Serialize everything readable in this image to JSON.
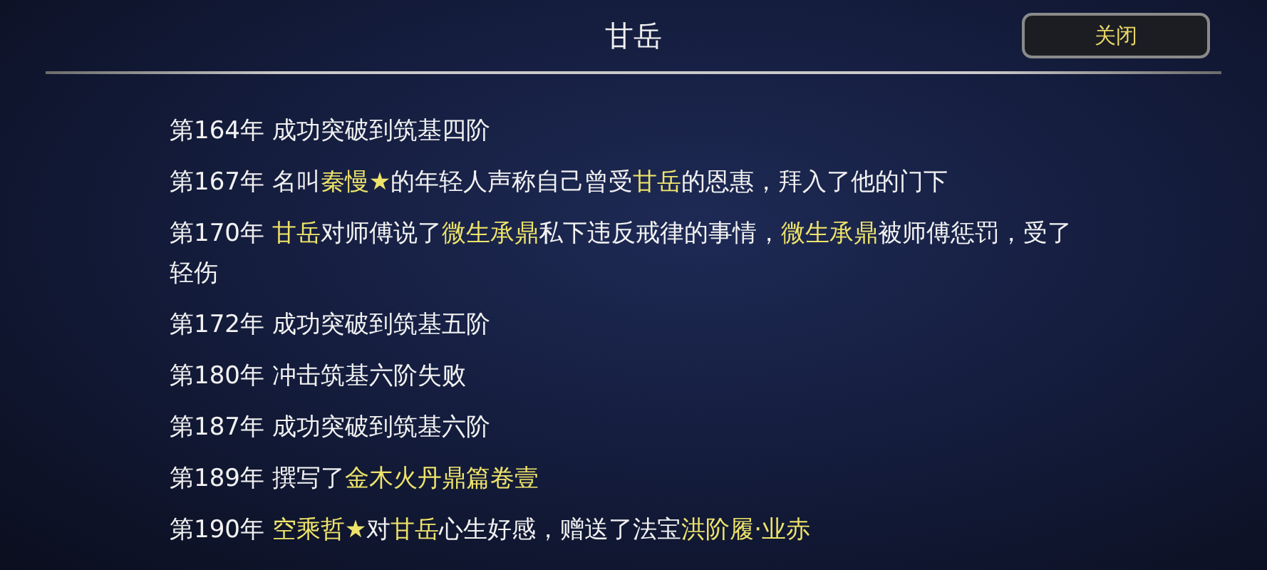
{
  "header": {
    "title": "甘岳",
    "close_button": "关闭"
  },
  "entries": [
    {
      "year": "第164年",
      "segments": [
        {
          "text": "成功突破到筑基四阶",
          "highlight": false
        }
      ]
    },
    {
      "year": "第167年",
      "segments": [
        {
          "text": "名叫",
          "highlight": false
        },
        {
          "text": "秦慢★",
          "highlight": true
        },
        {
          "text": "的年轻人声称自己曾受",
          "highlight": false
        },
        {
          "text": "甘岳",
          "highlight": true
        },
        {
          "text": "的恩惠，拜入了他的门下",
          "highlight": false
        }
      ]
    },
    {
      "year": "第170年",
      "segments": [
        {
          "text": "甘岳",
          "highlight": true
        },
        {
          "text": "对师傅说了",
          "highlight": false
        },
        {
          "text": "微生承鼎",
          "highlight": true
        },
        {
          "text": "私下违反戒律的事情，",
          "highlight": false
        },
        {
          "text": "微生承鼎",
          "highlight": true
        },
        {
          "text": "被师傅惩罚，受了轻伤",
          "highlight": false
        }
      ]
    },
    {
      "year": "第172年",
      "segments": [
        {
          "text": "成功突破到筑基五阶",
          "highlight": false
        }
      ]
    },
    {
      "year": "第180年",
      "segments": [
        {
          "text": "冲击筑基六阶失败",
          "highlight": false
        }
      ]
    },
    {
      "year": "第187年",
      "segments": [
        {
          "text": "成功突破到筑基六阶",
          "highlight": false
        }
      ]
    },
    {
      "year": "第189年",
      "segments": [
        {
          "text": "撰写了",
          "highlight": false
        },
        {
          "text": "金木火丹鼎篇卷壹",
          "highlight": true
        }
      ]
    },
    {
      "year": "第190年",
      "segments": [
        {
          "text": "空乘哲★",
          "highlight": true
        },
        {
          "text": "对",
          "highlight": false
        },
        {
          "text": "甘岳",
          "highlight": true
        },
        {
          "text": "心生好感，赠送了法宝",
          "highlight": false
        },
        {
          "text": "洪阶履·业赤",
          "highlight": true
        }
      ]
    }
  ]
}
